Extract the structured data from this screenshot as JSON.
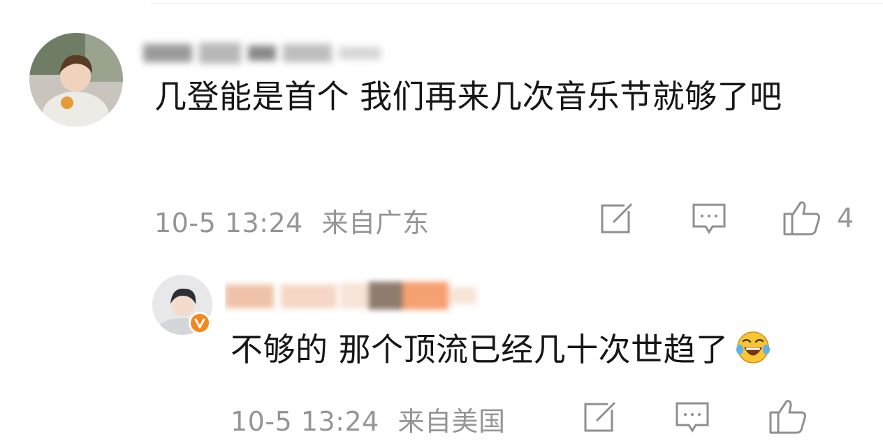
{
  "comments": [
    {
      "text": "几登能是首个 我们再来几次音乐节就够了吧",
      "time": "10-5 13:24",
      "location": "来自广东",
      "likes": "4",
      "icons": [
        "share-icon",
        "reply-icon",
        "thumb-up-icon"
      ]
    },
    {
      "text": "不够的 那个顶流已经几十次世趋了",
      "emoji": "laughing-crying-emoji",
      "time": "10-5 13:24",
      "location": "来自美国",
      "likes": "",
      "verified_badge": "v",
      "icons": [
        "share-icon",
        "reply-icon",
        "thumb-up-icon"
      ]
    }
  ],
  "colors": {
    "text": "#161616",
    "meta": "#959595",
    "icon": "#8f8f8f",
    "badge": "#f08a1f"
  }
}
